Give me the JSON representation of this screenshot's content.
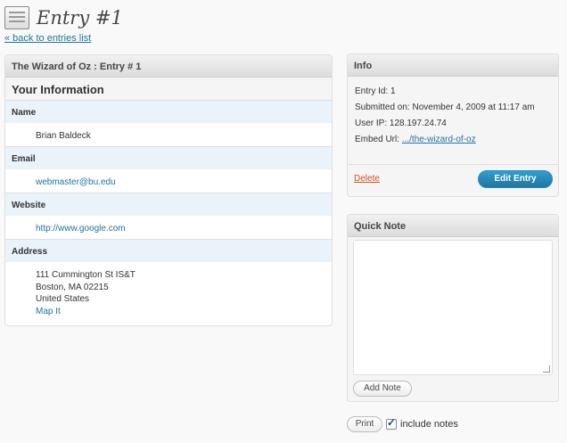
{
  "page": {
    "title": "Entry #1",
    "back_link": "« back to entries list"
  },
  "entry": {
    "header": "The Wizard of Oz : Entry # 1",
    "section_title": "Your Information",
    "fields": [
      {
        "label": "Name",
        "value": "Brian Baldeck"
      },
      {
        "label": "Email",
        "value": "webmaster@bu.edu"
      },
      {
        "label": "Website",
        "value": "http://www.google.com"
      },
      {
        "label": "Address",
        "lines": [
          "111 Cummington St IS&T",
          "Boston, MA 02215",
          "United States"
        ],
        "map_link": "Map It"
      }
    ]
  },
  "info": {
    "title": "Info",
    "entry_id": "Entry Id: 1",
    "submitted": "Submitted on: November 4, 2009 at 11:17 am",
    "user_ip": "User IP: 128.197.24.74",
    "embed_label": "Embed Url:",
    "embed_link": ".../the-wizard-of-oz",
    "delete_label": "Delete",
    "edit_label": "Edit Entry"
  },
  "quick_note": {
    "title": "Quick Note",
    "value": "",
    "add_label": "Add Note"
  },
  "print": {
    "button_label": "Print",
    "include_notes_label": "include notes",
    "include_notes_checked": true
  },
  "colors": {
    "link": "#21759b",
    "delete": "#d54e21",
    "primary_button": "#21759b",
    "field_label_bg": "#eaf2fa"
  }
}
